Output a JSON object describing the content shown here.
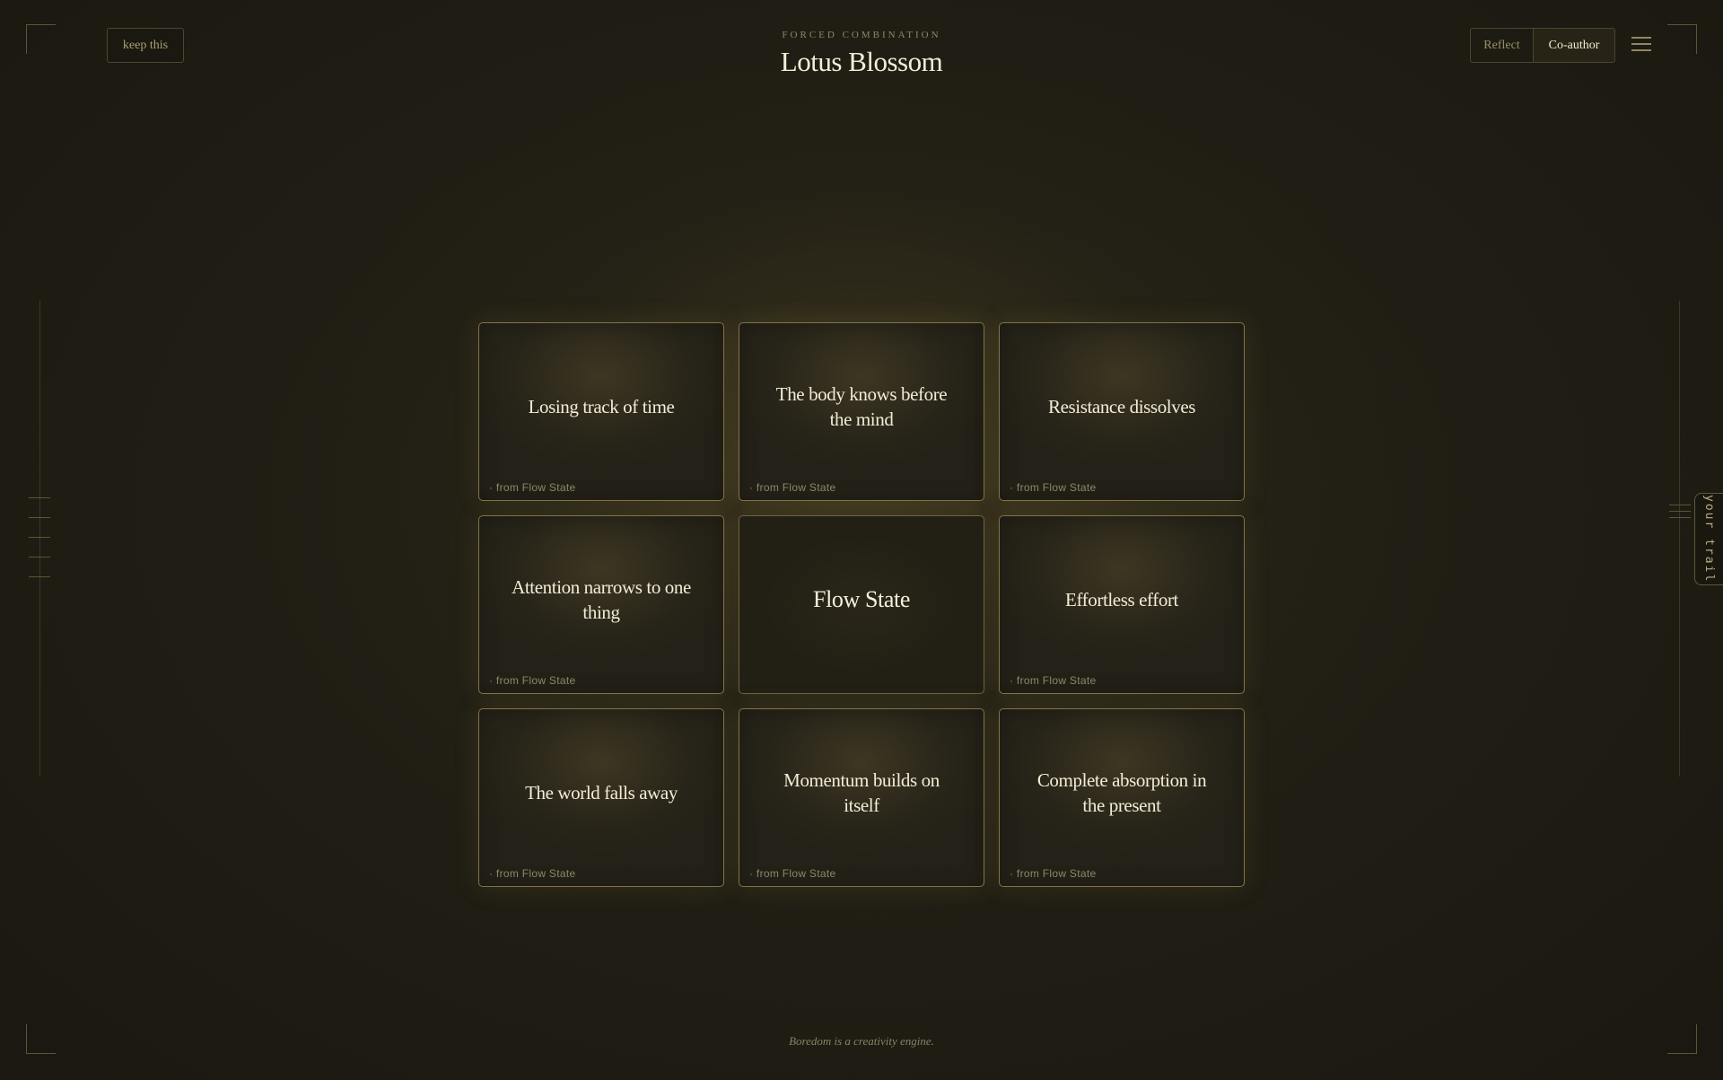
{
  "top_bar": {
    "keep_label": "keep this",
    "eyebrow": "FORCED COMBINATION",
    "title": "Lotus Blossom",
    "modes": [
      "Reflect",
      "Co-author"
    ],
    "active_mode": "Co-author",
    "menu_icon": "hamburger-icon"
  },
  "side_tab": {
    "label": "your trail"
  },
  "grid": {
    "cards": [
      {
        "prompt": "Losing track of time",
        "source": "· from Flow State"
      },
      {
        "prompt": "The body knows before the mind",
        "source": "· from Flow State"
      },
      {
        "prompt": "Resistance dissolves",
        "source": "· from Flow State"
      },
      {
        "prompt": "Attention narrows to one thing",
        "source": "· from Flow State"
      },
      {
        "prompt": "Flow State",
        "source": ""
      },
      {
        "prompt": "Effortless effort",
        "source": "· from Flow State"
      },
      {
        "prompt": "The world falls away",
        "source": "· from Flow State"
      },
      {
        "prompt": "Momentum builds on itself",
        "source": "· from Flow State"
      },
      {
        "prompt": "Complete absorption in the present",
        "source": "· from Flow State"
      }
    ]
  },
  "footer": {
    "note": "Boredom is a creativity engine."
  },
  "colors": {
    "background": "#1c1a11",
    "card_border": "#807447",
    "text_primary": "#f3ecd6",
    "text_muted": "#8d866a"
  }
}
